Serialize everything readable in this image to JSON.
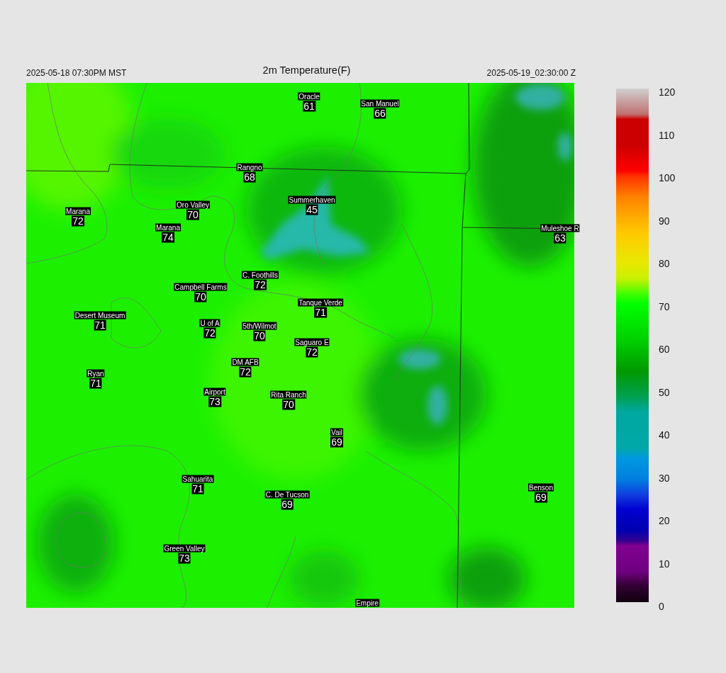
{
  "header": {
    "local_time": "2025-05-18 07:30PM MST",
    "title": "2m Temperature(F)",
    "valid_time": "2025-05-19_02:30:00 Z"
  },
  "stations": [
    {
      "name": "Oracle",
      "value": "61"
    },
    {
      "name": "San Manuel",
      "value": "66"
    },
    {
      "name": "Rangno",
      "value": "68"
    },
    {
      "name": "Summerhaven",
      "value": "45"
    },
    {
      "name": "Marana",
      "value": "72"
    },
    {
      "name": "Oro Valley",
      "value": "70"
    },
    {
      "name": "Marana",
      "value": "74"
    },
    {
      "name": "Muleshoe R",
      "value": "63"
    },
    {
      "name": "C. Foothills",
      "value": "72"
    },
    {
      "name": "Campbell Farms",
      "value": "70"
    },
    {
      "name": "Tanque Verde",
      "value": "71"
    },
    {
      "name": "Desert Museum",
      "value": "71"
    },
    {
      "name": "U of A",
      "value": "72"
    },
    {
      "name": "5th/Wilmot",
      "value": "70"
    },
    {
      "name": "Saguaro E",
      "value": "72"
    },
    {
      "name": "DM AFB",
      "value": "72"
    },
    {
      "name": "Ryan",
      "value": "71"
    },
    {
      "name": "Airport",
      "value": "73"
    },
    {
      "name": "Rita Ranch",
      "value": "70"
    },
    {
      "name": "Vail",
      "value": "69"
    },
    {
      "name": "Sahuarita",
      "value": "71"
    },
    {
      "name": "Benson",
      "value": "69"
    },
    {
      "name": "C. De Tucson",
      "value": "69"
    },
    {
      "name": "Green Valley",
      "value": "73"
    },
    {
      "name": "Empire"
    }
  ],
  "colorbar": {
    "ticks": [
      "120",
      "110",
      "100",
      "90",
      "80",
      "70",
      "60",
      "50",
      "40",
      "30",
      "20",
      "10",
      "0"
    ]
  }
}
